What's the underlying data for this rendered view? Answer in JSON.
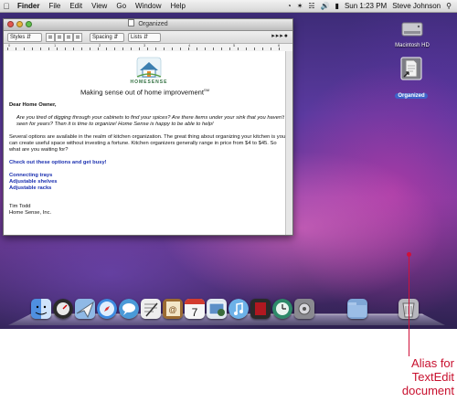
{
  "menubar": {
    "app": "Finder",
    "items": [
      "File",
      "Edit",
      "View",
      "Go",
      "Window",
      "Help"
    ],
    "clock": "Sun 1:23 PM",
    "user": "Steve Johnson"
  },
  "window": {
    "title": "Organized",
    "toolbar": {
      "styles": "Styles",
      "spacing": "Spacing",
      "lists": "Lists"
    },
    "ruler_numbers": [
      "0",
      "1",
      "2",
      "3",
      "4",
      "5",
      "6"
    ],
    "doc": {
      "logo_text": "HOMESENSE",
      "tagline": "Making sense out of home improvement",
      "tagline_sup": "SM",
      "greeting": "Dear Home Owner,",
      "para1": "Are you tired of digging through your cabinets to find your spices? Are there items under your sink that you haven't\nseen for years? Then it is time to organize! Home Sense is happy to be able to help!",
      "para2": "Several options are available in the realm of kitchen organization. The great thing about organizing your kitchen is you\ncan create useful space without investing a fortune. Kitchen organizers generally range in price from $4 to $45. So\nwhat are you waiting for?",
      "check_out": "Check out these options and get busy!",
      "links": [
        "Connecting trays",
        "Adjustable shelves",
        "Adjustable racks"
      ],
      "sign_name": "Tim Todd",
      "sign_company": "Home Sense, Inc."
    }
  },
  "desktop": {
    "hd_label": "Macintosh HD",
    "alias_label": "Organized"
  },
  "dock": [
    "finder",
    "dashboard",
    "mail",
    "safari",
    "ichat",
    "textedit",
    "address-book",
    "ical",
    "iphoto",
    "itunes",
    "front-row",
    "time-machine",
    "system-preferences",
    "applications-folder",
    "trash"
  ],
  "callout": {
    "lines": [
      "Alias for",
      "TextEdit",
      "document"
    ]
  },
  "colors": {
    "callout": "#c8102e",
    "link_blue": "#1a2fb0",
    "selection": "#3d63c9"
  }
}
